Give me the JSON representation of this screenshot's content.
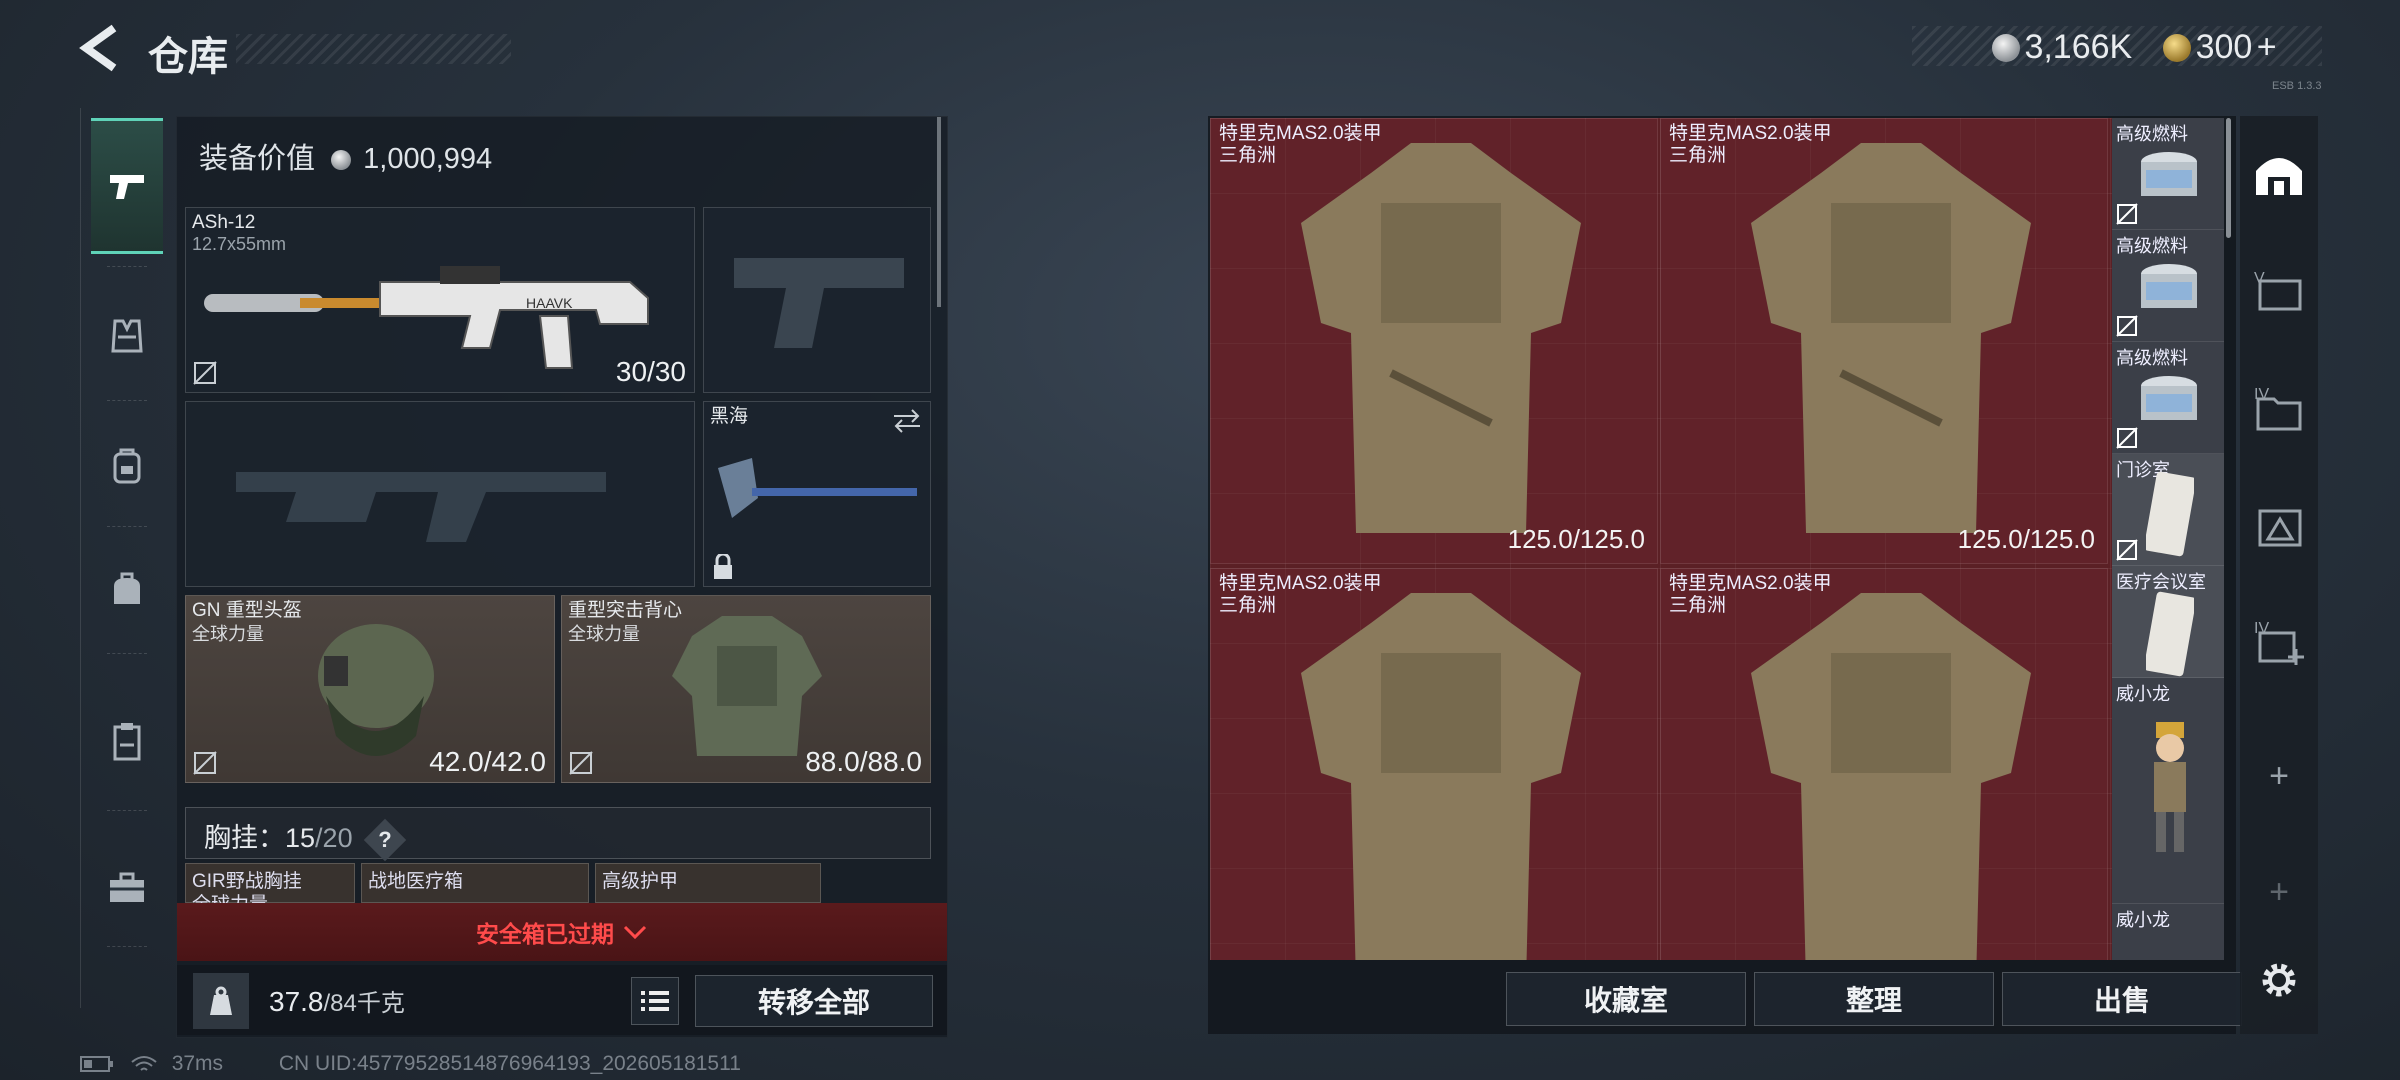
{
  "header": {
    "title": "仓库",
    "currency": [
      {
        "icon": "silver-coin-icon",
        "value": "3,166K"
      },
      {
        "icon": "gold-coin-icon",
        "value": "300"
      }
    ],
    "add_icon": "plus-icon",
    "version": "ESB 1.3.3"
  },
  "left_nav": [
    "pistol-icon",
    "vest-icon",
    "backpack-icon",
    "bag-icon",
    "clipboard-icon",
    "toolbox-icon"
  ],
  "equipment": {
    "value_label": "装备价值",
    "value": "1,000,994",
    "primary": {
      "name": "ASh-12",
      "caliber": "12.7x55mm",
      "ammo": "30/30"
    },
    "melee": {
      "name": "黑海"
    },
    "helmet": {
      "name": "GN 重型头盔",
      "maker": "全球力量",
      "durability": "42.0/42.0"
    },
    "armor": {
      "name": "重型突击背心",
      "maker": "全球力量",
      "durability": "88.0/88.0"
    },
    "chest_rig": {
      "label": "胸挂：",
      "used": "15",
      "capacity": "/20",
      "help": "?"
    },
    "rig_items": [
      "GIR野战胸挂",
      "战地医疗箱",
      "高级护甲"
    ],
    "rig_items_sub": [
      "全球力量"
    ],
    "safe_box": "安全箱已过期",
    "weight": {
      "current": "37.8",
      "max": "/84千克"
    },
    "transfer_all": "转移全部"
  },
  "stash": {
    "items": [
      {
        "name": "特里克MAS2.0装甲",
        "maker": "三角洲",
        "durability": "125.0/125.0"
      },
      {
        "name": "特里克MAS2.0装甲",
        "maker": "三角洲",
        "durability": "125.0/125.0"
      },
      {
        "name": "特里克MAS2.0装甲",
        "maker": "三角洲",
        "durability": ""
      },
      {
        "name": "特里克MAS2.0装甲",
        "maker": "三角洲",
        "durability": ""
      }
    ],
    "side_items": [
      "高级燃料",
      "高级燃料",
      "高级燃料",
      "门诊室",
      "医疗会议室",
      "威小龙",
      "威小龙"
    ],
    "buttons": {
      "collection": "收藏室",
      "organize": "整理",
      "sell": "出售"
    }
  },
  "right_rail": {
    "labels": [
      "",
      "V",
      "IV",
      "",
      "IV",
      "+",
      "+"
    ]
  },
  "status": {
    "ping": "37ms",
    "uid": "CN UID:45779528514876964193_202605181511"
  },
  "colors": {
    "accent": "#5fd3b8",
    "stash_bg": "#5b2025",
    "warning": "#ff4b4b"
  }
}
